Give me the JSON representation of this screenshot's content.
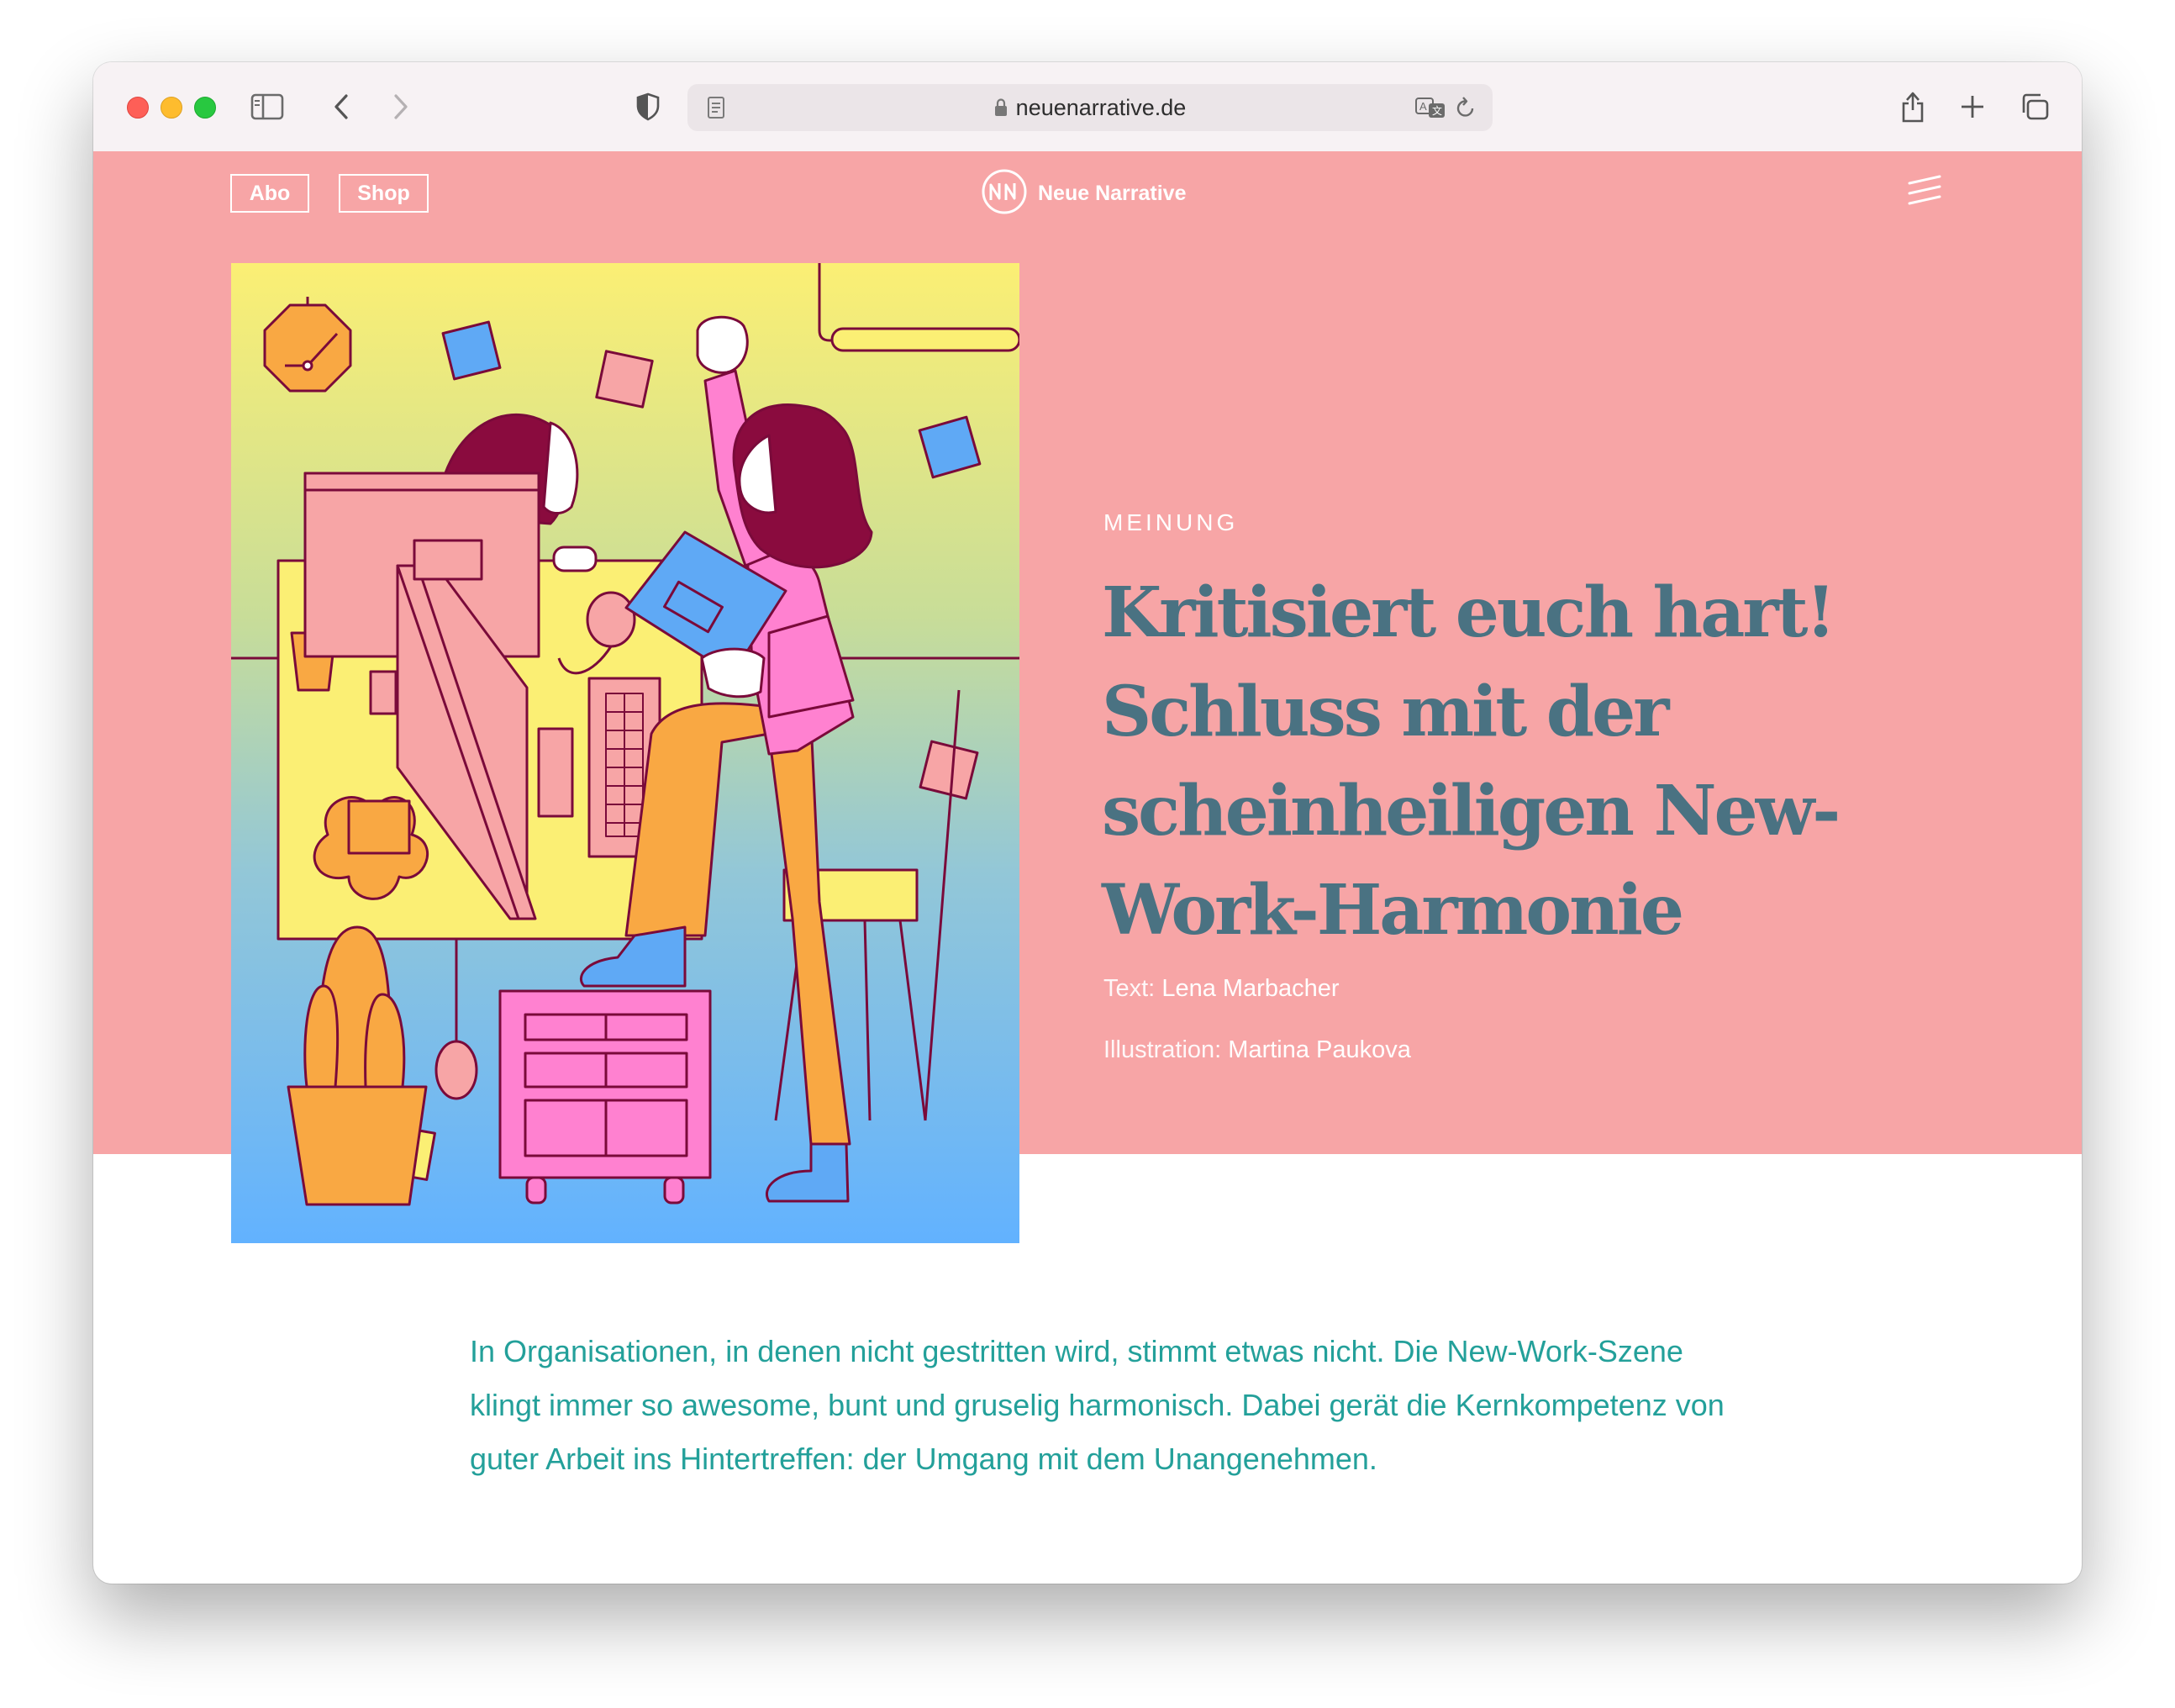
{
  "browser": {
    "url": "neuenarrative.de"
  },
  "site": {
    "nav": {
      "abo_label": "Abo",
      "shop_label": "Shop"
    },
    "brand_name": "Neue Narrative"
  },
  "article": {
    "category": "MEINUNG",
    "headline": "Kritisiert euch hart! Schluss mit der scheinheiligen New-Work-Harmonie",
    "text_label": "Text:",
    "author": "Lena Marbacher",
    "illustration_label": "Illustration:",
    "illustrator": "Martina Paukova",
    "intro": "In Organisationen, in denen nicht gestritten wird, stimmt etwas nicht. Die New-Work-Szene klingt immer so awesome, bunt und gruselig harmonisch. Dabei gerät die Kernkompetenz von guter Arbeit ins Hintertreffen: der Umgang mit dem Unangenehmen."
  },
  "colors": {
    "hero_background": "#f7a5a6",
    "headline": "#4a7282",
    "intro_text": "#23a09a",
    "illustration_outline": "#7a0a3a"
  },
  "icons": {
    "toolbar": [
      "sidebar-icon",
      "back-icon",
      "forward-icon",
      "privacy-shield-icon",
      "reader-icon",
      "lock-icon",
      "translate-icon",
      "reload-icon",
      "share-icon",
      "new-tab-icon",
      "tab-overview-icon"
    ],
    "site": [
      "brand-logo-icon",
      "menu-icon"
    ]
  }
}
